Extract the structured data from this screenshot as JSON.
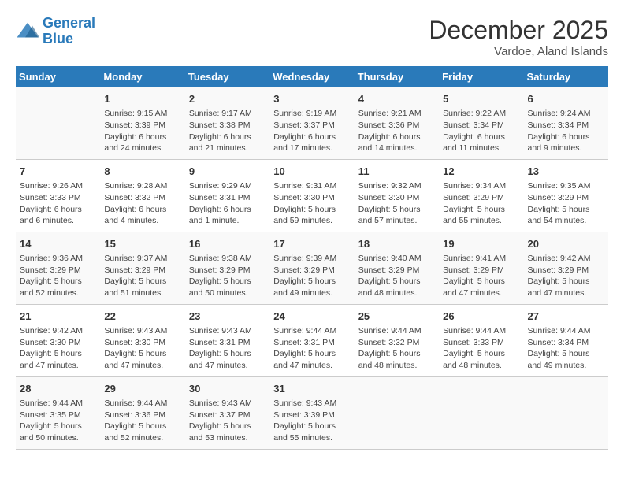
{
  "header": {
    "logo_line1": "General",
    "logo_line2": "Blue",
    "month": "December 2025",
    "location": "Vardoe, Aland Islands"
  },
  "weekdays": [
    "Sunday",
    "Monday",
    "Tuesday",
    "Wednesday",
    "Thursday",
    "Friday",
    "Saturday"
  ],
  "weeks": [
    [
      {
        "day": "",
        "sunrise": "",
        "sunset": "",
        "daylight": ""
      },
      {
        "day": "1",
        "sunrise": "Sunrise: 9:15 AM",
        "sunset": "Sunset: 3:39 PM",
        "daylight": "Daylight: 6 hours and 24 minutes."
      },
      {
        "day": "2",
        "sunrise": "Sunrise: 9:17 AM",
        "sunset": "Sunset: 3:38 PM",
        "daylight": "Daylight: 6 hours and 21 minutes."
      },
      {
        "day": "3",
        "sunrise": "Sunrise: 9:19 AM",
        "sunset": "Sunset: 3:37 PM",
        "daylight": "Daylight: 6 hours and 17 minutes."
      },
      {
        "day": "4",
        "sunrise": "Sunrise: 9:21 AM",
        "sunset": "Sunset: 3:36 PM",
        "daylight": "Daylight: 6 hours and 14 minutes."
      },
      {
        "day": "5",
        "sunrise": "Sunrise: 9:22 AM",
        "sunset": "Sunset: 3:34 PM",
        "daylight": "Daylight: 6 hours and 11 minutes."
      },
      {
        "day": "6",
        "sunrise": "Sunrise: 9:24 AM",
        "sunset": "Sunset: 3:34 PM",
        "daylight": "Daylight: 6 hours and 9 minutes."
      }
    ],
    [
      {
        "day": "7",
        "sunrise": "Sunrise: 9:26 AM",
        "sunset": "Sunset: 3:33 PM",
        "daylight": "Daylight: 6 hours and 6 minutes."
      },
      {
        "day": "8",
        "sunrise": "Sunrise: 9:28 AM",
        "sunset": "Sunset: 3:32 PM",
        "daylight": "Daylight: 6 hours and 4 minutes."
      },
      {
        "day": "9",
        "sunrise": "Sunrise: 9:29 AM",
        "sunset": "Sunset: 3:31 PM",
        "daylight": "Daylight: 6 hours and 1 minute."
      },
      {
        "day": "10",
        "sunrise": "Sunrise: 9:31 AM",
        "sunset": "Sunset: 3:30 PM",
        "daylight": "Daylight: 5 hours and 59 minutes."
      },
      {
        "day": "11",
        "sunrise": "Sunrise: 9:32 AM",
        "sunset": "Sunset: 3:30 PM",
        "daylight": "Daylight: 5 hours and 57 minutes."
      },
      {
        "day": "12",
        "sunrise": "Sunrise: 9:34 AM",
        "sunset": "Sunset: 3:29 PM",
        "daylight": "Daylight: 5 hours and 55 minutes."
      },
      {
        "day": "13",
        "sunrise": "Sunrise: 9:35 AM",
        "sunset": "Sunset: 3:29 PM",
        "daylight": "Daylight: 5 hours and 54 minutes."
      }
    ],
    [
      {
        "day": "14",
        "sunrise": "Sunrise: 9:36 AM",
        "sunset": "Sunset: 3:29 PM",
        "daylight": "Daylight: 5 hours and 52 minutes."
      },
      {
        "day": "15",
        "sunrise": "Sunrise: 9:37 AM",
        "sunset": "Sunset: 3:29 PM",
        "daylight": "Daylight: 5 hours and 51 minutes."
      },
      {
        "day": "16",
        "sunrise": "Sunrise: 9:38 AM",
        "sunset": "Sunset: 3:29 PM",
        "daylight": "Daylight: 5 hours and 50 minutes."
      },
      {
        "day": "17",
        "sunrise": "Sunrise: 9:39 AM",
        "sunset": "Sunset: 3:29 PM",
        "daylight": "Daylight: 5 hours and 49 minutes."
      },
      {
        "day": "18",
        "sunrise": "Sunrise: 9:40 AM",
        "sunset": "Sunset: 3:29 PM",
        "daylight": "Daylight: 5 hours and 48 minutes."
      },
      {
        "day": "19",
        "sunrise": "Sunrise: 9:41 AM",
        "sunset": "Sunset: 3:29 PM",
        "daylight": "Daylight: 5 hours and 47 minutes."
      },
      {
        "day": "20",
        "sunrise": "Sunrise: 9:42 AM",
        "sunset": "Sunset: 3:29 PM",
        "daylight": "Daylight: 5 hours and 47 minutes."
      }
    ],
    [
      {
        "day": "21",
        "sunrise": "Sunrise: 9:42 AM",
        "sunset": "Sunset: 3:30 PM",
        "daylight": "Daylight: 5 hours and 47 minutes."
      },
      {
        "day": "22",
        "sunrise": "Sunrise: 9:43 AM",
        "sunset": "Sunset: 3:30 PM",
        "daylight": "Daylight: 5 hours and 47 minutes."
      },
      {
        "day": "23",
        "sunrise": "Sunrise: 9:43 AM",
        "sunset": "Sunset: 3:31 PM",
        "daylight": "Daylight: 5 hours and 47 minutes."
      },
      {
        "day": "24",
        "sunrise": "Sunrise: 9:44 AM",
        "sunset": "Sunset: 3:31 PM",
        "daylight": "Daylight: 5 hours and 47 minutes."
      },
      {
        "day": "25",
        "sunrise": "Sunrise: 9:44 AM",
        "sunset": "Sunset: 3:32 PM",
        "daylight": "Daylight: 5 hours and 48 minutes."
      },
      {
        "day": "26",
        "sunrise": "Sunrise: 9:44 AM",
        "sunset": "Sunset: 3:33 PM",
        "daylight": "Daylight: 5 hours and 48 minutes."
      },
      {
        "day": "27",
        "sunrise": "Sunrise: 9:44 AM",
        "sunset": "Sunset: 3:34 PM",
        "daylight": "Daylight: 5 hours and 49 minutes."
      }
    ],
    [
      {
        "day": "28",
        "sunrise": "Sunrise: 9:44 AM",
        "sunset": "Sunset: 3:35 PM",
        "daylight": "Daylight: 5 hours and 50 minutes."
      },
      {
        "day": "29",
        "sunrise": "Sunrise: 9:44 AM",
        "sunset": "Sunset: 3:36 PM",
        "daylight": "Daylight: 5 hours and 52 minutes."
      },
      {
        "day": "30",
        "sunrise": "Sunrise: 9:43 AM",
        "sunset": "Sunset: 3:37 PM",
        "daylight": "Daylight: 5 hours and 53 minutes."
      },
      {
        "day": "31",
        "sunrise": "Sunrise: 9:43 AM",
        "sunset": "Sunset: 3:39 PM",
        "daylight": "Daylight: 5 hours and 55 minutes."
      },
      {
        "day": "",
        "sunrise": "",
        "sunset": "",
        "daylight": ""
      },
      {
        "day": "",
        "sunrise": "",
        "sunset": "",
        "daylight": ""
      },
      {
        "day": "",
        "sunrise": "",
        "sunset": "",
        "daylight": ""
      }
    ]
  ]
}
